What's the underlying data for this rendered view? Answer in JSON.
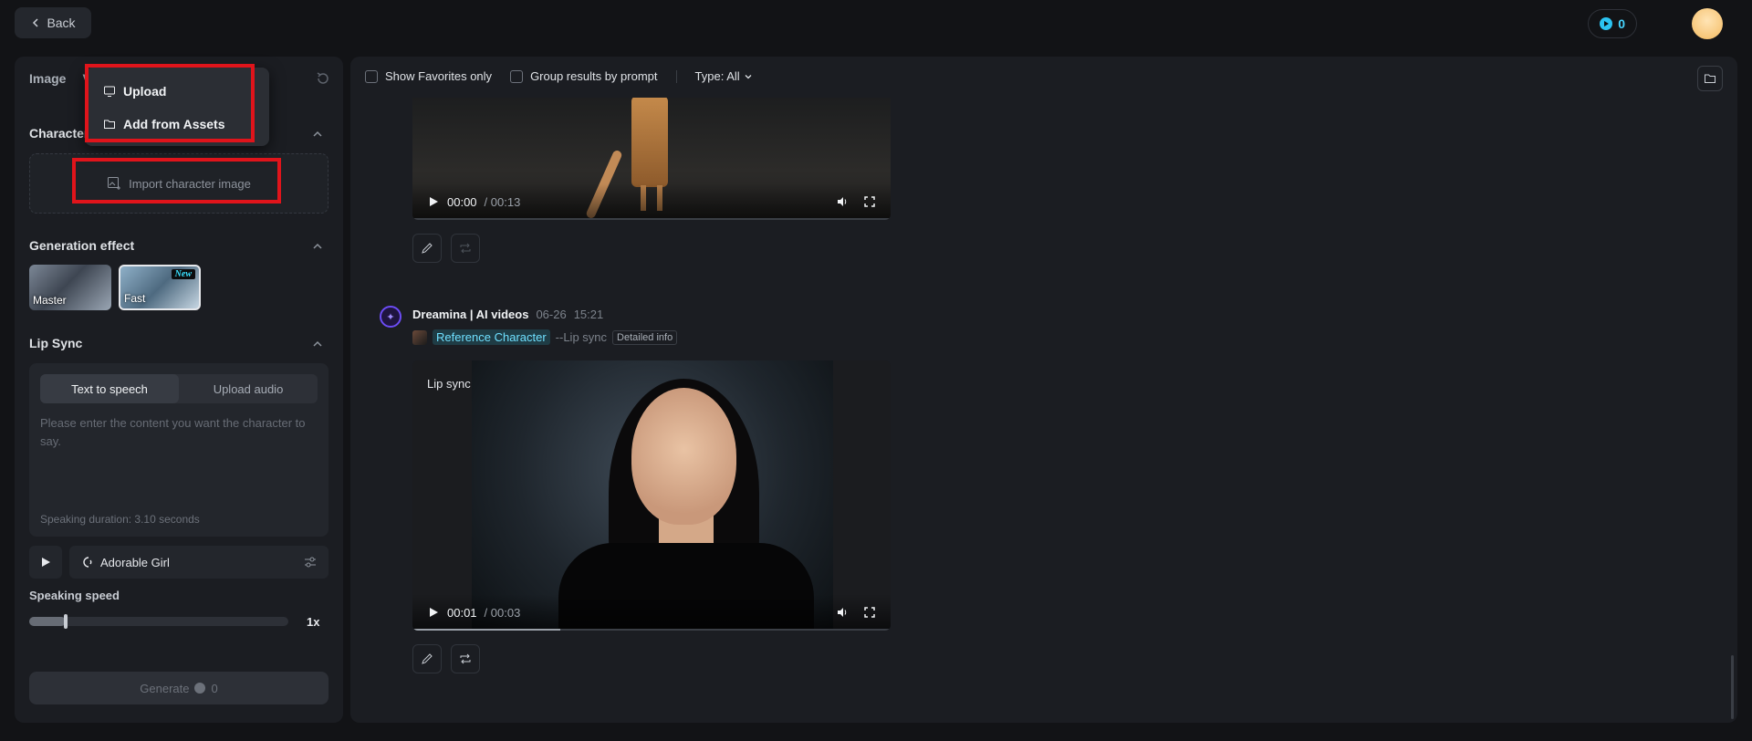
{
  "header": {
    "back_label": "Back",
    "credits": "0"
  },
  "left": {
    "tabs": [
      "Image",
      "V"
    ],
    "character": {
      "title": "Character",
      "import_label": "Import character image"
    },
    "generation_effect": {
      "title": "Generation effect",
      "options": [
        {
          "label": "Master",
          "selected": false
        },
        {
          "label": "Fast",
          "selected": true,
          "badge": "New"
        }
      ]
    },
    "lip_sync": {
      "title": "Lip Sync",
      "modes": [
        "Text to speech",
        "Upload audio"
      ],
      "active_mode": "Text to speech",
      "placeholder": "Please enter the content you want the character to say.",
      "duration": "Speaking duration: 3.10 seconds",
      "voice": "Adorable Girl"
    },
    "speed": {
      "label": "Speaking speed",
      "value": "1x",
      "level": 0.14
    },
    "generate": {
      "label": "Generate",
      "cost": "0"
    }
  },
  "upload_menu": {
    "items": [
      "Upload",
      "Add from Assets"
    ]
  },
  "main": {
    "toolbar": {
      "favorites": "Show Favorites only",
      "group": "Group results by prompt",
      "type": "Type: All"
    },
    "video1": {
      "time": "00:00",
      "duration": "/ 00:13",
      "progress": 0
    },
    "message": {
      "author": "Dreamina | AI videos",
      "date": "06-26",
      "time": "15:21",
      "reference_tag": "Reference Character",
      "lip_arg": "--Lip sync",
      "detail_label": "Detailed info"
    },
    "video2": {
      "label": "Lip sync",
      "time": "00:01",
      "duration": "/ 00:03",
      "progress": 0.31
    }
  },
  "colors": {
    "accent": "#46d5ff",
    "highlight_box": "#e0141b",
    "panel": "#1b1d22",
    "background": "#121316"
  }
}
